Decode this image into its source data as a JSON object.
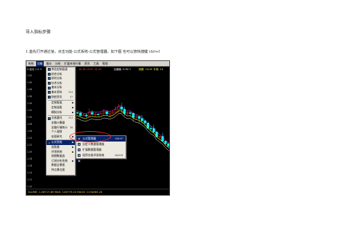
{
  "document": {
    "title": "导入指标步骤",
    "step1": "1.首先打开通达信，点击功能-公式系统-公式管理器，如下图    也可以按快捷键 ctrl+f"
  },
  "screenshot": {
    "menubar": [
      "系统",
      "功能",
      "报价",
      "分析",
      "扩展市场行情",
      "资讯",
      "工具",
      "帮助"
    ],
    "active_menu_index": 1,
    "infobar": {
      "symbol": "0.蓝色 1.0.3",
      "ma1": "14.30  15.07  15.22",
      "ma2": "加速度: 0.92.7",
      "ma3": "指数: 14.31  平线: 14"
    },
    "left_rows": [
      "1.42",
      "1.40",
      "1.38",
      "1.36",
      "1.34",
      "1.32",
      "1.30",
      "1.28",
      "1.26",
      "1.24",
      "1.22",
      "1.20",
      "1.18",
      "1.16",
      "1.14",
      "1.12",
      "1.10"
    ],
    "function_menu": [
      {
        "label": "常设定制画面",
        "shortcut": "",
        "arrow": false,
        "icon": true
      },
      {
        "label": "综合分析",
        "shortcut": "",
        "arrow": false,
        "icon": true
      },
      {
        "label": "即时分析",
        "shortcut": "",
        "arrow": false,
        "icon": true
      },
      {
        "label": "技术分析",
        "shortcut": "",
        "arrow": false,
        "icon": true
      },
      {
        "label": "基本分析",
        "shortcut": "",
        "arrow": false,
        "icon": true
      },
      {
        "label": "基本资料",
        "shortcut": "F10",
        "arrow": false,
        "icon": true
      },
      {
        "label": "财经资讯",
        "shortcut": "F7",
        "arrow": false,
        "icon": true
      },
      {
        "sep": true
      },
      {
        "label": "定制版面",
        "shortcut": "",
        "arrow": true,
        "icon": false
      },
      {
        "label": "定制选股",
        "shortcut": "",
        "arrow": true,
        "icon": false
      },
      {
        "label": "模拟分析",
        "shortcut": "",
        "arrow": true,
        "icon": false
      },
      {
        "sep": true
      },
      {
        "label": "交易委托",
        "shortcut": "F12",
        "arrow": false,
        "icon": true
      },
      {
        "label": "金融计算器",
        "shortcut": "",
        "arrow": false,
        "icon": false
      },
      {
        "label": "金融行情统计",
        "shortcut": "30",
        "arrow": false,
        "icon": false
      },
      {
        "label": "个人理财",
        "shortcut": "",
        "arrow": false,
        "icon": false
      },
      {
        "label": "宏观研究",
        "shortcut": "",
        "arrow": true,
        "icon": false
      },
      {
        "sep": true
      },
      {
        "label": "公式系统",
        "shortcut": "",
        "arrow": true,
        "icon": true,
        "selected": true
      },
      {
        "label": "选股器",
        "shortcut": "",
        "arrow": true,
        "icon": false
      },
      {
        "label": "评测系统",
        "shortcut": "",
        "arrow": true,
        "icon": false
      },
      {
        "label": "周期数据选",
        "shortcut": "",
        "arrow": false,
        "icon": false
      },
      {
        "label": "订阅分析系统",
        "shortcut": "",
        "arrow": true,
        "icon": false
      },
      {
        "label": "数据全景图",
        "shortcut": "",
        "arrow": false,
        "icon": false
      },
      {
        "label": "特点景位图",
        "shortcut": "",
        "arrow": false,
        "icon": false
      }
    ],
    "formula_submenu": [
      {
        "label": "公式管理器",
        "shortcut": "Ctrl+F",
        "selected": true
      },
      {
        "label": "自定义数据管理器",
        "shortcut": ""
      },
      {
        "label": "扩展数据管理器",
        "shortcut": ""
      },
      {
        "label": "程序交易评测系统",
        "shortcut": "Ctrl+D"
      },
      {
        "label": "探索最佳指标系统",
        "shortcut": ""
      }
    ],
    "status": "OLUME: 1.28717.89  MA5: 128779.20  MA10: 1134083.20"
  },
  "colors": {
    "chart_bg": "#000000",
    "up_candle": "#ff3030",
    "down_candle": "#00ffff",
    "ma_yellow": "#ffff00",
    "ma_white": "#ffffff",
    "ma_magenta": "#ff40ff",
    "highlight": "#0a246a",
    "annotation": "#ff2a2a"
  }
}
